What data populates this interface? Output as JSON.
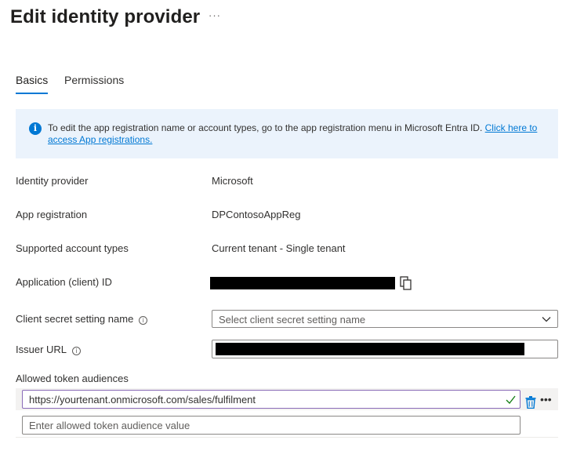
{
  "header": {
    "title": "Edit identity provider",
    "more": "···"
  },
  "tabs": [
    {
      "label": "Basics",
      "active": true
    },
    {
      "label": "Permissions",
      "active": false
    }
  ],
  "info": {
    "icon": "info-icon",
    "text": "To edit the app registration name or account types, go to the app registration menu in Microsoft Entra ID. ",
    "link": "Click here to access App registrations."
  },
  "fields": {
    "identity_provider": {
      "label": "Identity provider",
      "value": "Microsoft"
    },
    "app_registration": {
      "label": "App registration",
      "value": "DPContosoAppReg"
    },
    "account_types": {
      "label": "Supported account types",
      "value": "Current tenant - Single tenant"
    },
    "client_id": {
      "label": "Application (client) ID",
      "value": ""
    },
    "client_secret": {
      "label": "Client secret setting name",
      "placeholder": "Select client secret setting name"
    },
    "issuer_url": {
      "label": "Issuer URL",
      "value": ""
    },
    "audiences": {
      "label": "Allowed token audiences",
      "values": [
        "https://yourtenant.onmicrosoft.com/sales/fulfilment"
      ],
      "placeholder": "Enter allowed token audience value"
    }
  },
  "colors": {
    "accent": "#0078d4",
    "info_bg": "#ebf3fc",
    "valid": "#107c10"
  }
}
